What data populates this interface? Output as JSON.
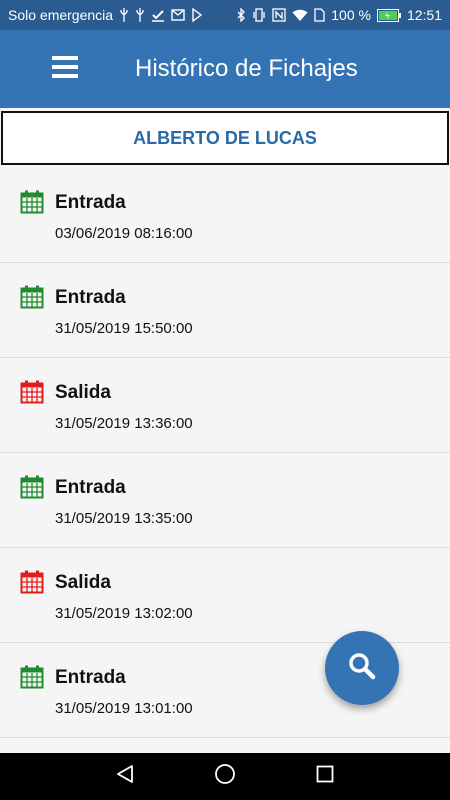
{
  "status_bar": {
    "carrier": "Solo emergencia",
    "battery": "100 %",
    "time": "12:51",
    "left_icons": [
      "usb-icon",
      "usb-icon",
      "check-icon",
      "mail-icon",
      "download-icon"
    ],
    "right_icons": [
      "bluetooth-icon",
      "vibrate-icon",
      "nfc-icon",
      "wifi-icon",
      "sim-icon",
      "battery-icon"
    ]
  },
  "app_bar": {
    "title": "Histórico de Fichajes",
    "menu_icon": "hamburger-menu-icon"
  },
  "user": {
    "name": "ALBERTO DE LUCAS"
  },
  "records": [
    {
      "type": "Entrada",
      "datetime": "03/06/2019 08:16:00",
      "color": "#1f8a2e"
    },
    {
      "type": "Entrada",
      "datetime": "31/05/2019 15:50:00",
      "color": "#1f8a2e"
    },
    {
      "type": "Salida",
      "datetime": "31/05/2019 13:36:00",
      "color": "#e31d1d"
    },
    {
      "type": "Entrada",
      "datetime": "31/05/2019 13:35:00",
      "color": "#1f8a2e"
    },
    {
      "type": "Salida",
      "datetime": "31/05/2019 13:02:00",
      "color": "#e31d1d"
    },
    {
      "type": "Entrada",
      "datetime": "31/05/2019 13:01:00",
      "color": "#1f8a2e"
    }
  ],
  "fab": {
    "icon": "search-icon"
  },
  "nav_bar": {
    "buttons": [
      "back-icon",
      "home-icon",
      "recents-icon"
    ]
  },
  "colors": {
    "status_bar": "#2b5c91",
    "app_bar": "#3574b4",
    "accent": "#2b6aaa",
    "entrada": "#1f8a2e",
    "salida": "#e31d1d"
  }
}
